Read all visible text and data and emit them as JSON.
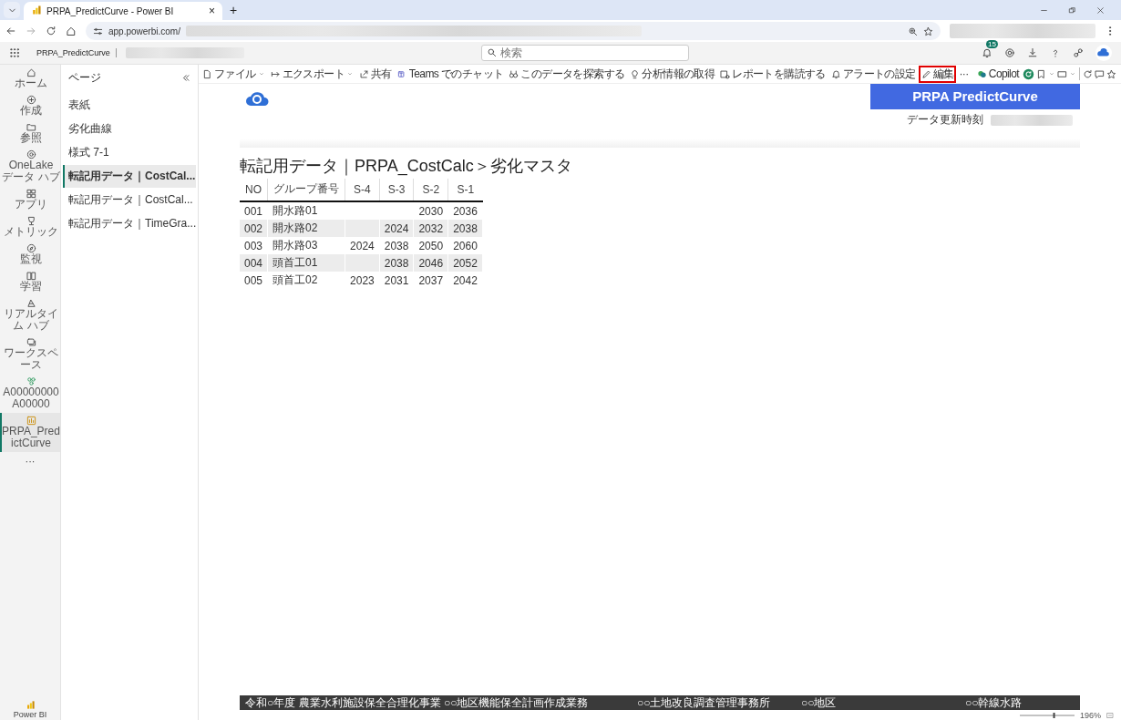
{
  "browser": {
    "tab": {
      "title": "PRPA_PredictCurve - Power BI",
      "close": "×"
    },
    "new_tab": "+",
    "address": "app.powerbi.com/"
  },
  "header": {
    "report_name": "PRPA_PredictCurve",
    "search": {
      "placeholder": "検索"
    },
    "notification_count": "15"
  },
  "rail": [
    {
      "label": "ホーム",
      "selected": false
    },
    {
      "label": "作成",
      "selected": false
    },
    {
      "label": "参照",
      "selected": false
    },
    {
      "label": "OneLake データ ハブ",
      "selected": false
    },
    {
      "label": "アプリ",
      "selected": false
    },
    {
      "label": "メトリック",
      "selected": false
    },
    {
      "label": "監視",
      "selected": false
    },
    {
      "label": "学習",
      "selected": false
    },
    {
      "label": "リアルタイム ハブ",
      "selected": false
    },
    {
      "label": "ワークスペース",
      "selected": false
    },
    {
      "label": "A00000000A00000",
      "selected": false
    },
    {
      "label": "PRPA_PredictCurve",
      "selected": true
    }
  ],
  "rail_more": "···",
  "rail_brand": "Power BI",
  "pages": {
    "title": "ページ",
    "items": [
      {
        "label": "表紙",
        "selected": false
      },
      {
        "label": "劣化曲線",
        "selected": false
      },
      {
        "label": "様式 7-1",
        "selected": false
      },
      {
        "label": "転記用データ｜CostCal...",
        "selected": true
      },
      {
        "label": "転記用データ｜CostCal...",
        "selected": false
      },
      {
        "label": "転記用データ｜TimeGra...",
        "selected": false
      }
    ]
  },
  "toolbar": {
    "items": [
      {
        "label": "ファイル",
        "dropdown": true,
        "highlighted": false
      },
      {
        "label": "エクスポート",
        "dropdown": true,
        "highlighted": false
      },
      {
        "label": "共有",
        "dropdown": false,
        "highlighted": false
      },
      {
        "label": "Teams でのチャット",
        "dropdown": false,
        "highlighted": false
      },
      {
        "label": "このデータを探索する",
        "dropdown": false,
        "highlighted": false
      },
      {
        "label": "分析情報の取得",
        "dropdown": false,
        "highlighted": false
      },
      {
        "label": "レポートを購読する",
        "dropdown": false,
        "highlighted": false
      },
      {
        "label": "アラートの設定",
        "dropdown": false,
        "highlighted": false
      },
      {
        "label": "編集",
        "dropdown": false,
        "highlighted": true
      }
    ],
    "more": "···",
    "copilot": "Copilot"
  },
  "report": {
    "banner": "PRPA PredictCurve",
    "update_label": "データ更新時刻",
    "heading": "転記用データ｜PRPA_CostCalc＞劣化マスタ",
    "table": {
      "columns": [
        "NO",
        "グループ番号",
        "S-4",
        "S-3",
        "S-2",
        "S-1"
      ],
      "rows": [
        [
          "001",
          "開水路01",
          null,
          null,
          "2030",
          "2036"
        ],
        [
          "002",
          "開水路02",
          null,
          "2024",
          "2032",
          "2038"
        ],
        [
          "003",
          "開水路03",
          "2024",
          "2038",
          "2050",
          "2060"
        ],
        [
          "004",
          "頭首工01",
          null,
          "2038",
          "2046",
          "2052"
        ],
        [
          "005",
          "頭首工02",
          "2023",
          "2031",
          "2037",
          "2042"
        ]
      ]
    },
    "footer": [
      "令和○年度 農業水利施設保全合理化事業 ○○地区機能保全計画作成業務",
      "○○土地改良調査管理事務所",
      "○○地区",
      "○○幹線水路"
    ]
  },
  "status": {
    "zoom_slider": {
      "level": 0.63
    },
    "zoom": "196%"
  }
}
